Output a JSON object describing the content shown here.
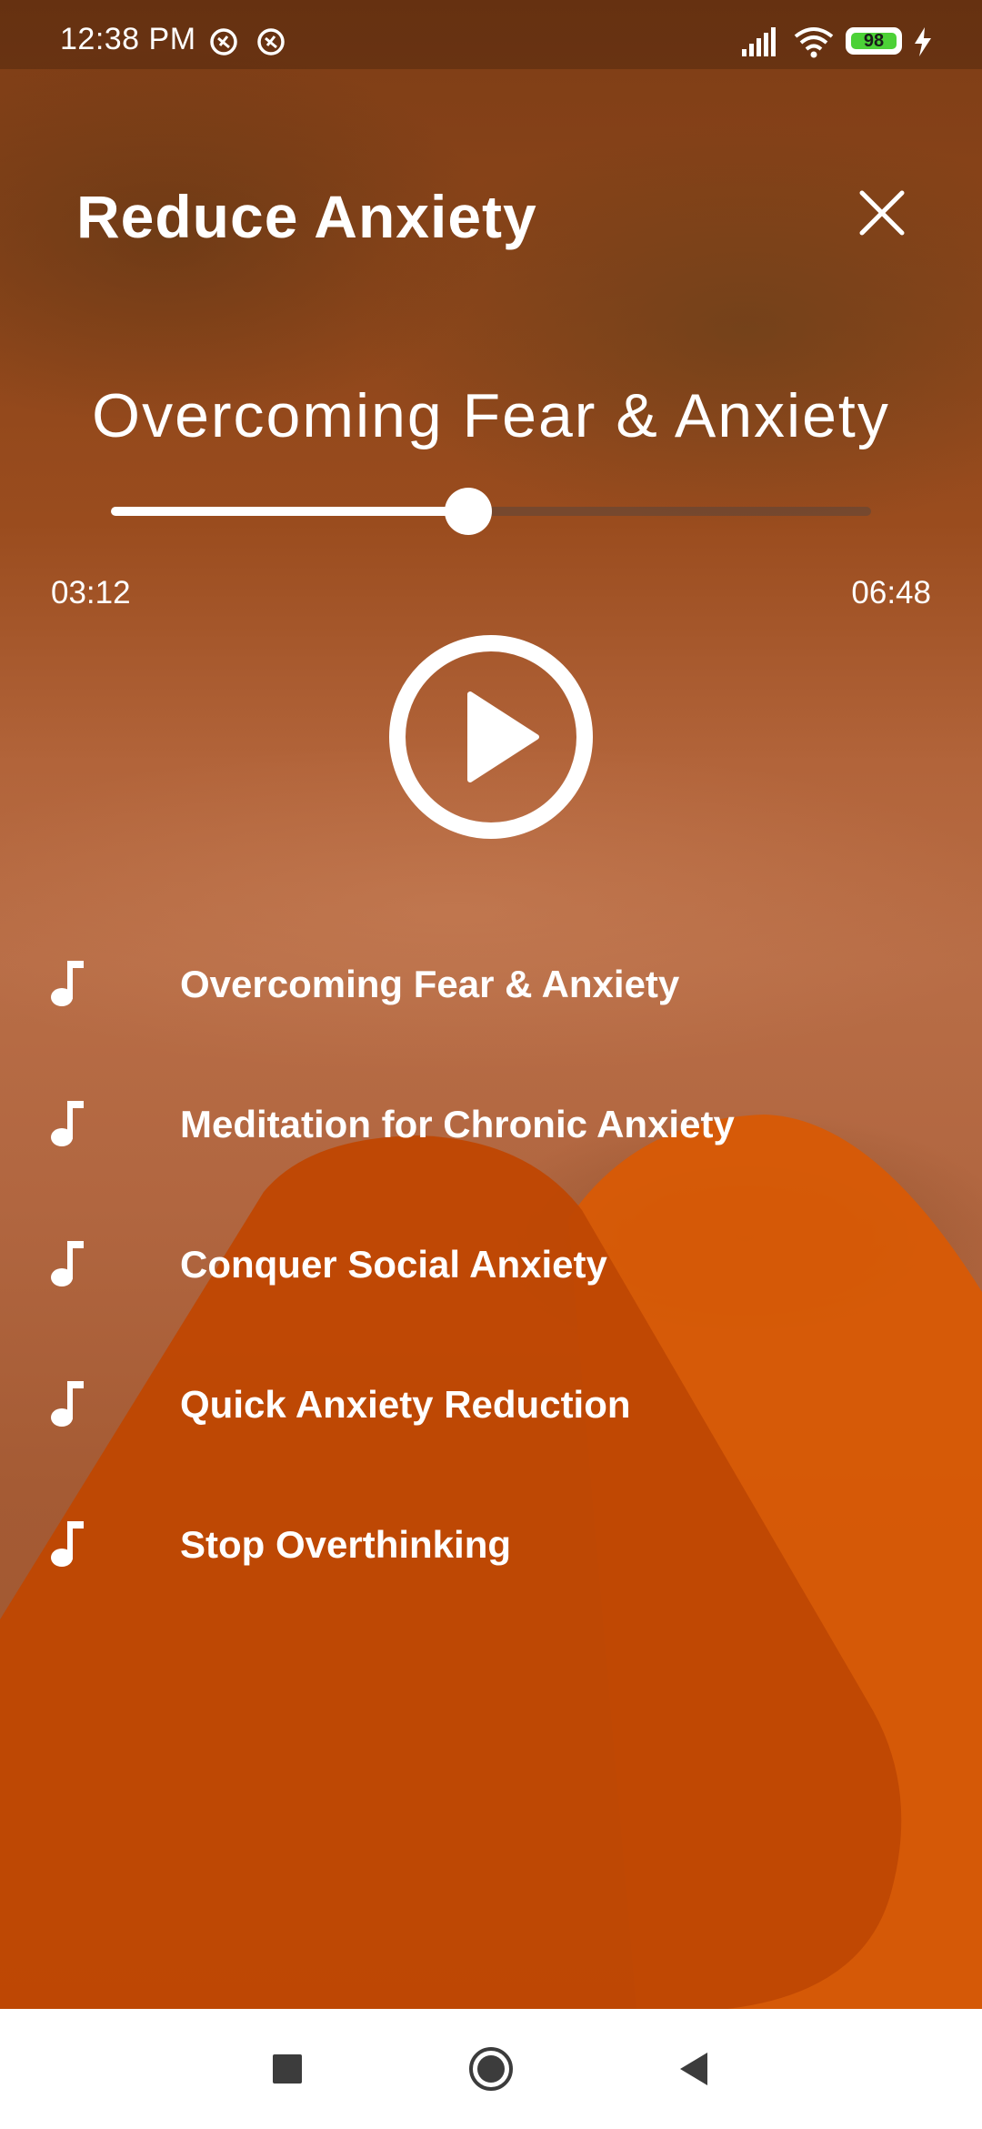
{
  "status_bar": {
    "time": "12:38 PM",
    "battery_level": "98",
    "icons": [
      "notification-icon",
      "notification-icon",
      "signal-icon",
      "wifi-icon",
      "battery-icon",
      "charging-bolt-icon"
    ]
  },
  "header": {
    "title": "Reduce Anxiety",
    "close_icon": "close-icon"
  },
  "player": {
    "track_title": "Overcoming Fear & Anxiety",
    "current_time": "03:12",
    "total_time": "06:48",
    "progress_fraction": 0.47,
    "play_icon": "play-icon"
  },
  "playlist": {
    "item_icon": "music-note-icon",
    "items": [
      {
        "label": "Overcoming Fear & Anxiety"
      },
      {
        "label": "Meditation for Chronic Anxiety"
      },
      {
        "label": "Conquer Social Anxiety"
      },
      {
        "label": "Quick Anxiety Reduction"
      },
      {
        "label": "Stop Overthinking"
      }
    ]
  },
  "nav_bar": {
    "icons": [
      "recents-icon",
      "home-icon",
      "back-icon"
    ]
  },
  "colors": {
    "accent_dark": "#c04a05",
    "accent_light": "#d85a05",
    "text": "#ffffff"
  }
}
